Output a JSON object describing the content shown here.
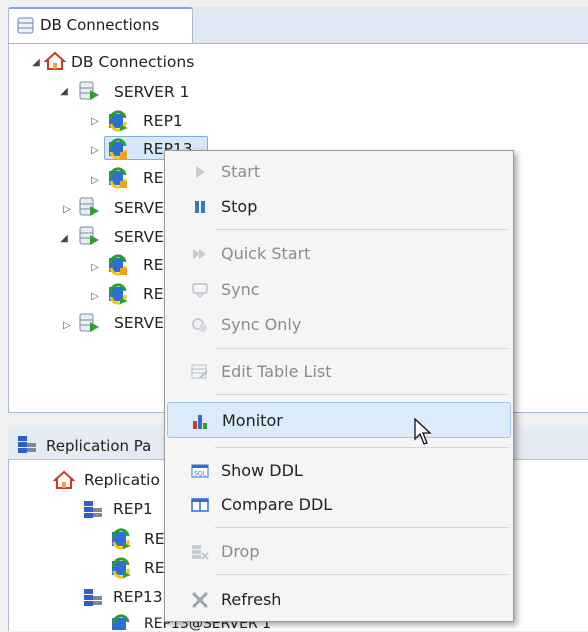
{
  "top_tab": {
    "label": "DB Connections"
  },
  "tree": {
    "root": "DB Connections",
    "server1": "SERVER 1",
    "rep1": "REP1",
    "rep13": "REP13",
    "rep_c": "RE",
    "server_b": "SERVE",
    "server_c": "SERVE",
    "rep_d": "RE",
    "rep_e": "RE",
    "server_d": "SERVE"
  },
  "bottom_tab": {
    "label": "Replication Pa"
  },
  "bottom_tree": {
    "root": "Replicatio",
    "rep1": "REP1",
    "rep1_a": "RE",
    "rep1_b": "RE",
    "rep13": "REP13",
    "rep13_a": "REP13@SERVER 1"
  },
  "menu": {
    "start": "Start",
    "stop": "Stop",
    "quick_start": "Quick Start",
    "sync": "Sync",
    "sync_only": "Sync Only",
    "edit_table_list": "Edit Table List",
    "monitor": "Monitor",
    "show_ddl": "Show DDL",
    "compare_ddl": "Compare DDL",
    "drop": "Drop",
    "refresh": "Refresh"
  },
  "icons": {
    "sql_badge": "SQL"
  },
  "colors": {
    "selection_bg": "#d8e8fb",
    "hover_bg": "#dcebfc",
    "tab_accent": "#7fa7e3"
  }
}
